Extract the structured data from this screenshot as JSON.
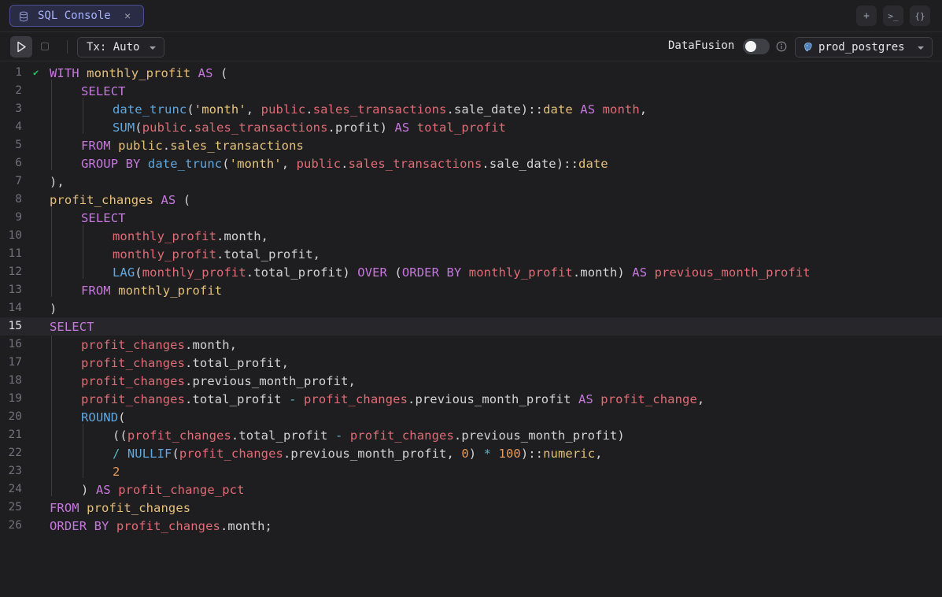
{
  "tab": {
    "label": "SQL Console",
    "close": "×"
  },
  "window_buttons": {
    "add": "+",
    "terminal": ">_",
    "json": "{}"
  },
  "toolbar": {
    "tx_mode": "Tx: Auto",
    "datafusion_label": "DataFusion",
    "datafusion_enabled": false,
    "connection": "prod_postgres"
  },
  "editor": {
    "active_line": 15,
    "lines": [
      "1",
      "2",
      "3",
      "4",
      "5",
      "6",
      "7",
      "8",
      "9",
      "10",
      "11",
      "12",
      "13",
      "14",
      "15",
      "16",
      "17",
      "18",
      "19",
      "20",
      "21",
      "22",
      "23",
      "24",
      "25",
      "26"
    ]
  }
}
